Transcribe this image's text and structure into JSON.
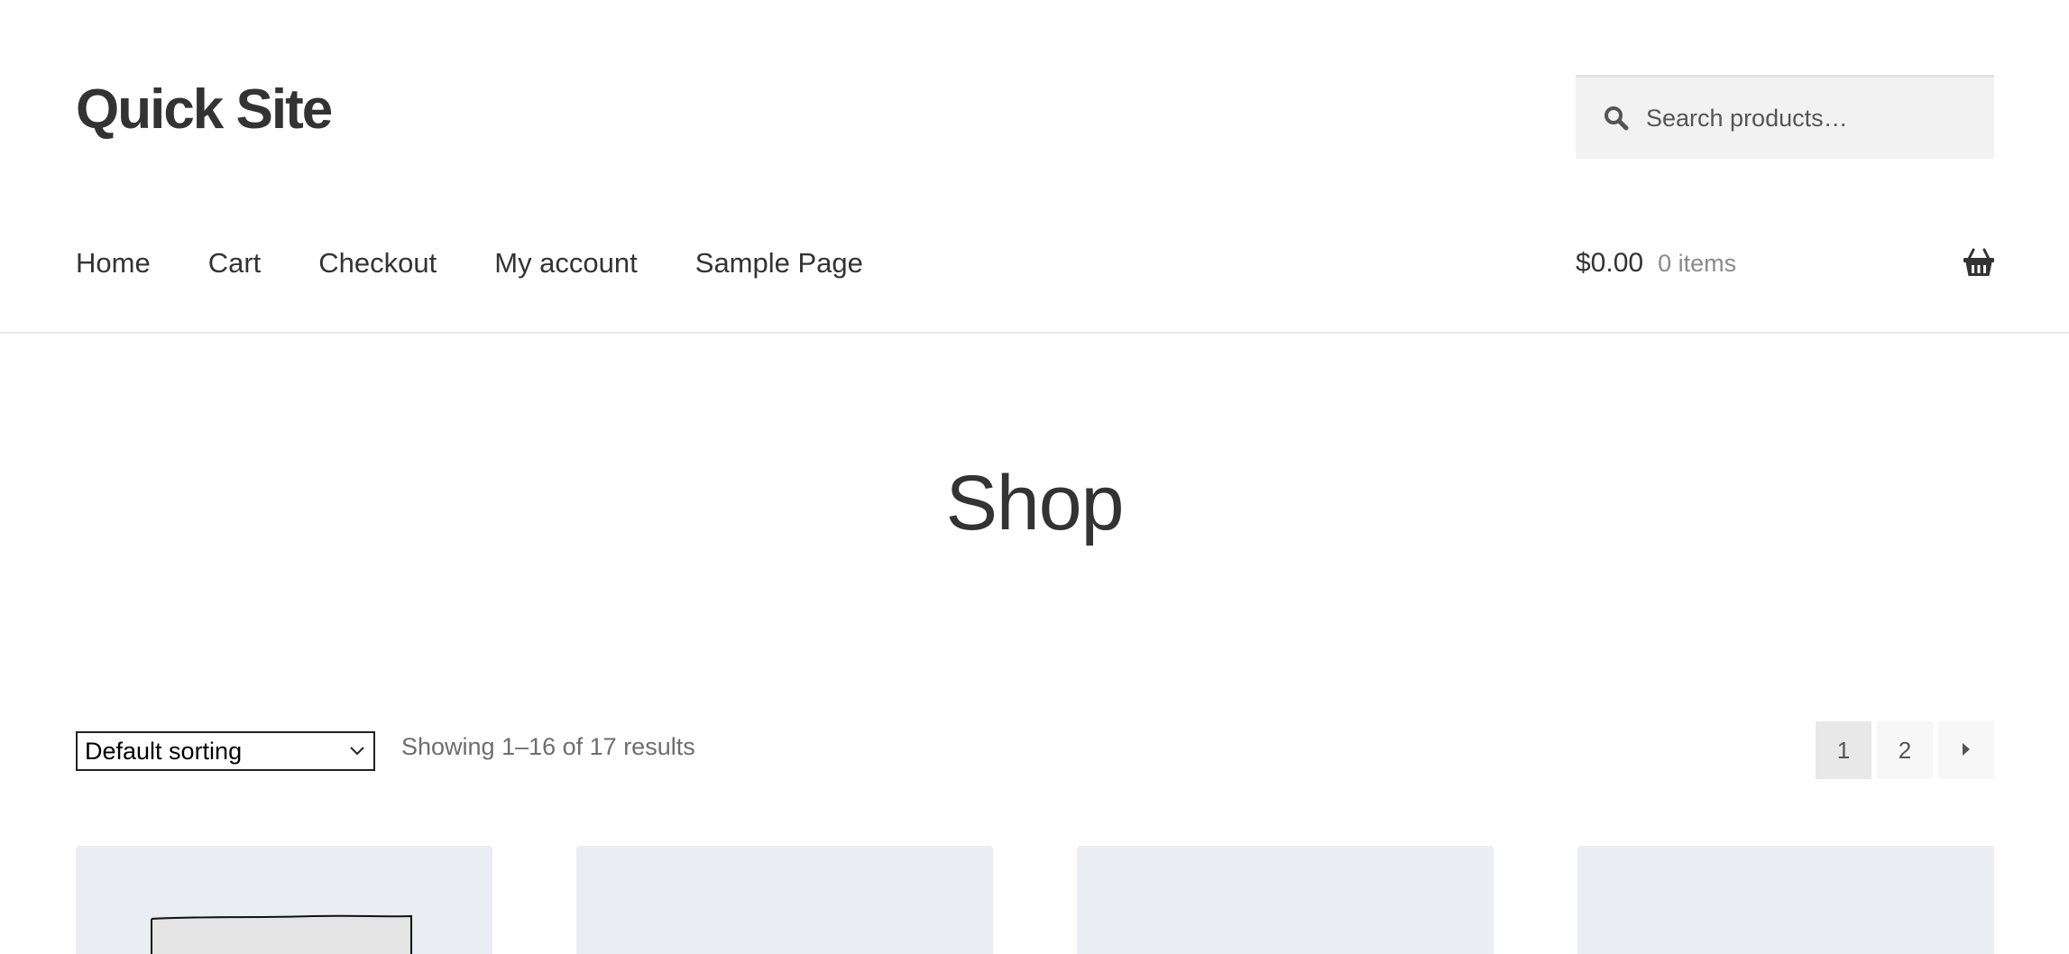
{
  "site": {
    "title": "Quick Site"
  },
  "search": {
    "placeholder": "Search products…",
    "icon": "search-icon"
  },
  "nav": {
    "items": [
      {
        "label": "Home"
      },
      {
        "label": "Cart"
      },
      {
        "label": "Checkout"
      },
      {
        "label": "My account"
      },
      {
        "label": "Sample Page"
      }
    ]
  },
  "cart": {
    "amount": "$0.00",
    "count": "0 items",
    "icon": "basket-icon"
  },
  "page": {
    "title": "Shop"
  },
  "toolbar": {
    "sort_selected": "Default sorting",
    "result_count": "Showing 1–16 of 17 results"
  },
  "pagination": {
    "pages": [
      "1",
      "2"
    ],
    "current": "1",
    "next_icon": "next-arrow-icon"
  },
  "colors": {
    "text": "#333333",
    "muted": "#6d6d6d",
    "search_bg": "#f2f2f2",
    "card_bg": "#eaeef2",
    "page_current_bg": "#e8e8e8",
    "page_bg": "#f7f7f7"
  }
}
